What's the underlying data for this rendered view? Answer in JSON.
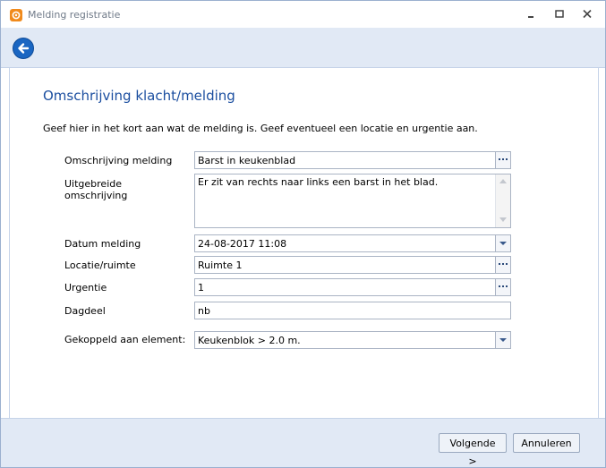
{
  "window": {
    "title": "Melding registratie"
  },
  "page": {
    "heading": "Omschrijving klacht/melding",
    "intro": "Geef hier in het kort aan wat de melding is. Geef eventueel een locatie en urgentie aan."
  },
  "form": {
    "omschrijving": {
      "label": "Omschrijving melding",
      "value": "Barst in keukenblad"
    },
    "uitgebreide": {
      "label_line1": "Uitgebreide",
      "label_line2": "omschrijving",
      "value": "Er zit van rechts naar links een barst in het blad."
    },
    "datum": {
      "label": "Datum melding",
      "value": "24-08-2017 11:08"
    },
    "locatie": {
      "label": "Locatie/ruimte",
      "value": "Ruimte 1"
    },
    "urgentie": {
      "label": "Urgentie",
      "value": "1"
    },
    "dagdeel": {
      "label": "Dagdeel",
      "value": "nb"
    },
    "element": {
      "label": "Gekoppeld aan element:",
      "value": "Keukenblok > 2.0 m."
    }
  },
  "footer": {
    "next_label": "Volgende >",
    "cancel_label": "Annuleren"
  }
}
